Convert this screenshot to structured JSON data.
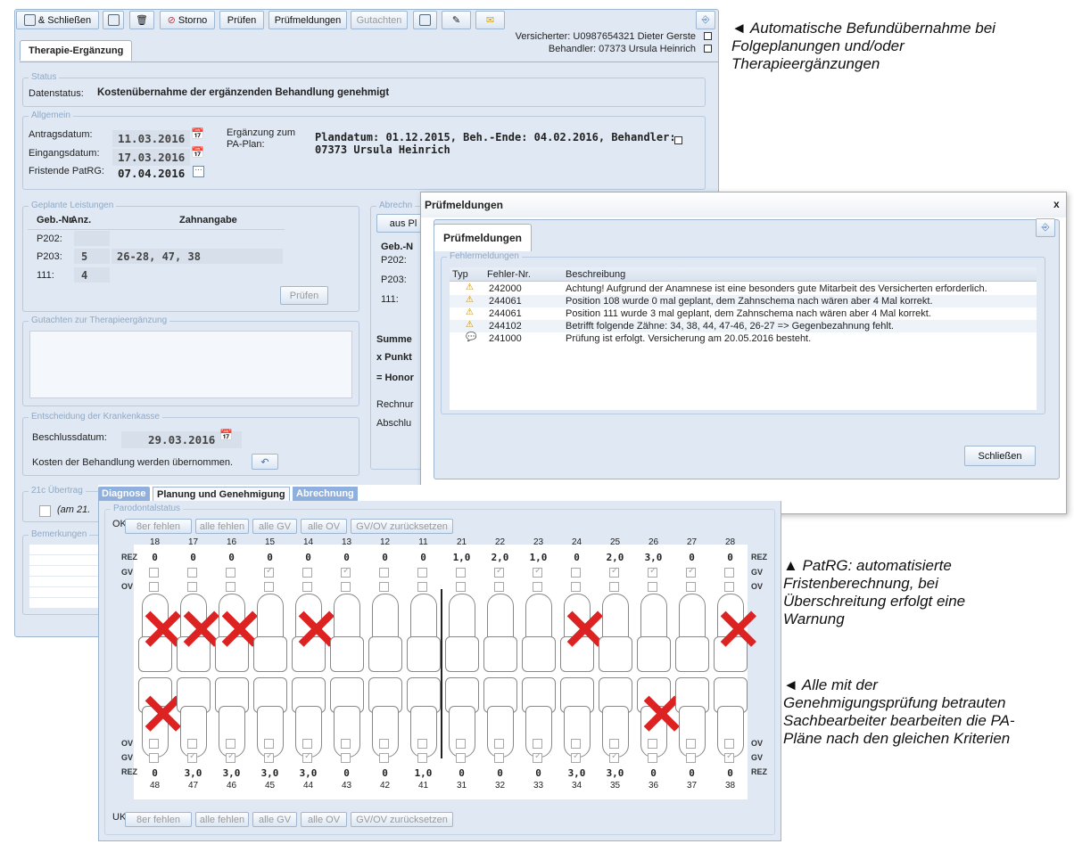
{
  "toolbar": {
    "save_close": "& Schließen",
    "storno": "Storno",
    "pruefen": "Prüfen",
    "pruefmeldungen": "Prüfmeldungen",
    "gutachten": "Gutachten"
  },
  "header": {
    "versicherter": "Versicherter: U0987654321 Dieter Gerste",
    "behandler": "Behandler: 07373 Ursula Heinrich",
    "tab": "Therapie-Ergänzung"
  },
  "status": {
    "legend": "Status",
    "label": "Datenstatus:",
    "value": "Kostenübernahme der ergänzenden Behandlung genehmigt"
  },
  "allgemein": {
    "legend": "Allgemein",
    "antrag_label": "Antragsdatum:",
    "antrag": "11.03.2016",
    "eingang_label": "Eingangsdatum:",
    "eingang": "17.03.2016",
    "frist_label": "Fristende PatRG:",
    "frist": "07.04.2016",
    "ergaenzung_label1": "Ergänzung zum",
    "ergaenzung_label2": "PA-Plan:",
    "plan_line1": "Plandatum: 01.12.2015, Beh.-Ende: 04.02.2016, Behandler:",
    "plan_line2": "07373 Ursula Heinrich"
  },
  "leistungen": {
    "legend": "Geplante Leistungen",
    "headers": [
      "Geb.-Nr.",
      "Anz.",
      "Zahnangabe"
    ],
    "rows": [
      [
        "P202:",
        "",
        ""
      ],
      [
        "P203:",
        "5",
        "26-28, 47, 38"
      ],
      [
        "111:",
        "4",
        ""
      ]
    ],
    "pruefen": "Prüfen"
  },
  "abrechnung": {
    "legend": "Abrechn",
    "btn": "aus Pl",
    "header": "Geb.-N",
    "rows": [
      "P202:",
      "P203:",
      "111:"
    ],
    "summe": "Summe",
    "punkt": "x Punkt",
    "honor": "= Honor",
    "rechnung": "Rechnur",
    "abschluss": "Abschlu"
  },
  "gutachten_legend": "Gutachten zur Therapieergänzung",
  "entscheidung": {
    "legend": "Entscheidung der Krankenkasse",
    "beschluss_label": "Beschlussdatum:",
    "beschluss": "29.03.2016",
    "kosten": "Kosten der Behandlung werden übernommen."
  },
  "uebertrag": {
    "legend": "21c Übertrag",
    "text": "(am 21."
  },
  "bemerkungen": "Bemerkungen",
  "dialog": {
    "title": "Prüfmeldungen",
    "close_x": "x",
    "tab": "Prüfmeldungen",
    "legend": "Fehlermeldungen",
    "headers": [
      "Typ",
      "Fehler-Nr.",
      "Beschreibung"
    ],
    "rows": [
      {
        "type": "warn",
        "nr": "242000",
        "text": "Achtung! Aufgrund der Anamnese ist eine besonders gute Mitarbeit des Versicherten erforderlich."
      },
      {
        "type": "warn",
        "nr": "244061",
        "text": "Position 108 wurde 0 mal geplant, dem Zahnschema nach wären aber 4 Mal korrekt."
      },
      {
        "type": "warn",
        "nr": "244061",
        "text": "Position 111 wurde 3 mal geplant, dem Zahnschema nach wären aber 4 Mal korrekt."
      },
      {
        "type": "warn",
        "nr": "244102",
        "text": "Betrifft folgende Zähne: 34, 38, 44, 47-46, 26-27 => Gegenbezahnung fehlt."
      },
      {
        "type": "info",
        "nr": "241000",
        "text": "Prüfung ist erfolgt. Versicherung am 20.05.2016 besteht."
      }
    ],
    "close_btn": "Schließen"
  },
  "chart": {
    "tabs": [
      "Diagnose",
      "Planung und Genehmigung",
      "Abrechnung"
    ],
    "legend": "Parodontalstatus",
    "ok": "OK",
    "uk": "UK",
    "buttons": [
      "8er fehlen",
      "alle fehlen",
      "alle GV",
      "alle OV",
      "GV/OV zurücksetzen"
    ],
    "row_labels": {
      "rez": "REZ",
      "gv": "GV",
      "ov": "OV"
    },
    "upper_teeth": [
      "18",
      "17",
      "16",
      "15",
      "14",
      "13",
      "12",
      "11",
      "21",
      "22",
      "23",
      "24",
      "25",
      "26",
      "27",
      "28"
    ],
    "upper_rez": [
      "0",
      "0",
      "0",
      "0",
      "0",
      "0",
      "0",
      "0",
      "1,0",
      "2,0",
      "1,0",
      "0",
      "2,0",
      "3,0",
      "0",
      "0"
    ],
    "upper_gv": [
      false,
      false,
      false,
      true,
      false,
      true,
      false,
      false,
      false,
      true,
      true,
      false,
      true,
      true,
      true,
      false
    ],
    "upper_missing": [
      true,
      true,
      true,
      false,
      true,
      false,
      false,
      false,
      false,
      false,
      false,
      true,
      false,
      false,
      false,
      true
    ],
    "lower_teeth": [
      "48",
      "47",
      "46",
      "45",
      "44",
      "43",
      "42",
      "41",
      "31",
      "32",
      "33",
      "34",
      "35",
      "36",
      "37",
      "38"
    ],
    "lower_rez": [
      "0",
      "3,0",
      "3,0",
      "3,0",
      "3,0",
      "0",
      "0",
      "1,0",
      "0",
      "0",
      "0",
      "3,0",
      "3,0",
      "0",
      "0",
      "0"
    ],
    "lower_gv": [
      false,
      true,
      true,
      true,
      true,
      false,
      false,
      false,
      false,
      false,
      true,
      true,
      true,
      false,
      false,
      true
    ],
    "lower_missing": [
      true,
      false,
      false,
      false,
      false,
      false,
      false,
      false,
      false,
      false,
      false,
      false,
      false,
      true,
      false,
      false
    ]
  },
  "notes": {
    "n1": [
      "◄ Automatische Befundübernahme bei",
      "Folgeplanungen und/oder",
      "Therapieergänzungen"
    ],
    "n2": [
      "▲ PatRG: automatisierte",
      "Fristenberechnung, bei",
      "Überschreitung erfolgt eine",
      "Warnung"
    ],
    "n3": [
      "◄ Alle mit der",
      "Genehmigungsprüfung betrauten",
      "Sachbearbeiter bearbeiten die PA-",
      "Pläne nach den gleichen Kriterien"
    ]
  }
}
